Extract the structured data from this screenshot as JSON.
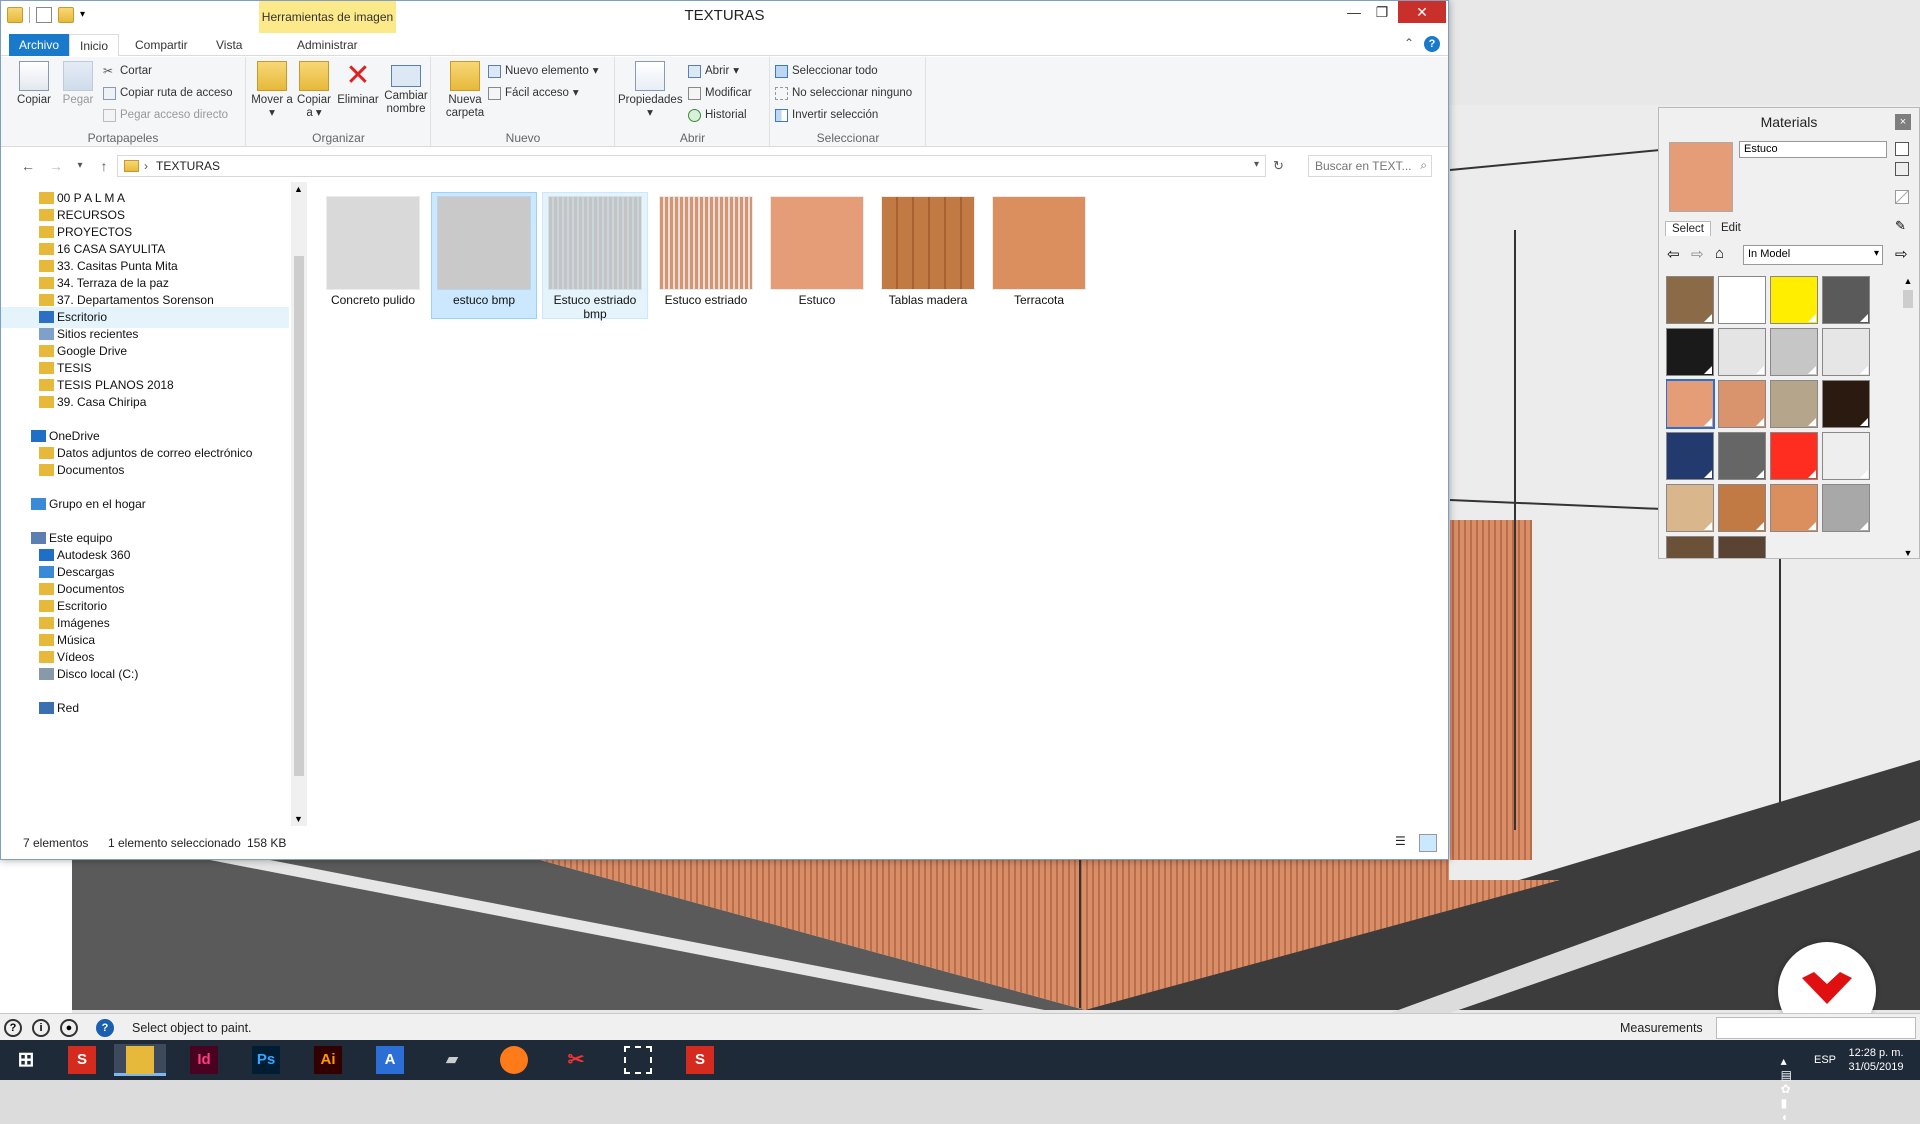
{
  "window": {
    "title": "TEXTURAS",
    "context_tab": "Herramientas de imagen",
    "minimize": "—",
    "maximize": "❐",
    "close": "✕"
  },
  "ribbon": {
    "tabs": [
      "Archivo",
      "Inicio",
      "Compartir",
      "Vista",
      "Administrar"
    ],
    "portapapeles": {
      "label": "Portapapeles",
      "copiar": "Copiar",
      "pegar": "Pegar",
      "cortar": "Cortar",
      "copiar_ruta": "Copiar ruta de acceso",
      "pegar_acceso": "Pegar acceso directo"
    },
    "organizar": {
      "label": "Organizar",
      "mover": "Mover a",
      "copiar": "Copiar a",
      "eliminar": "Eliminar",
      "cambiar": "Cambiar nombre"
    },
    "nuevo": {
      "label": "Nuevo",
      "nueva_carpeta": "Nueva carpeta",
      "nuevo_elemento": "Nuevo elemento",
      "facil_acceso": "Fácil acceso"
    },
    "abrir": {
      "label": "Abrir",
      "propiedades": "Propiedades",
      "abrir": "Abrir",
      "modificar": "Modificar",
      "historial": "Historial"
    },
    "seleccionar": {
      "label": "Seleccionar",
      "todo": "Seleccionar todo",
      "ninguno": "No seleccionar ninguno",
      "invertir": "Invertir selección"
    }
  },
  "address": {
    "path": "TEXTURAS",
    "search_placeholder": "Buscar en TEXT..."
  },
  "navpane": [
    {
      "label": "00 P A L M A",
      "icon": "folder"
    },
    {
      "label": "RECURSOS",
      "icon": "folder"
    },
    {
      "label": "PROYECTOS",
      "icon": "folder"
    },
    {
      "label": "16 CASA SAYULITA",
      "icon": "folder"
    },
    {
      "label": "33. Casitas Punta Mita",
      "icon": "folder"
    },
    {
      "label": "34. Terraza de la paz",
      "icon": "folder"
    },
    {
      "label": "37. Departamentos Sorenson",
      "icon": "folder"
    },
    {
      "label": "Escritorio",
      "icon": "desktop"
    },
    {
      "label": "Sitios recientes",
      "icon": "recent"
    },
    {
      "label": "Google Drive",
      "icon": "folder"
    },
    {
      "label": "TESIS",
      "icon": "folder"
    },
    {
      "label": "TESIS PLANOS 2018",
      "icon": "folder"
    },
    {
      "label": "39. Casa Chiripa",
      "icon": "folder"
    },
    {
      "label": "OneDrive",
      "icon": "cloud"
    },
    {
      "label": "Datos adjuntos de correo electrónico",
      "icon": "folder"
    },
    {
      "label": "Documentos",
      "icon": "folder"
    },
    {
      "label": "Grupo en el hogar",
      "icon": "homegroup"
    },
    {
      "label": "Este equipo",
      "icon": "computer"
    },
    {
      "label": "Autodesk 360",
      "icon": "cloud"
    },
    {
      "label": "Descargas",
      "icon": "download"
    },
    {
      "label": "Documentos",
      "icon": "folder"
    },
    {
      "label": "Escritorio",
      "icon": "folder"
    },
    {
      "label": "Imágenes",
      "icon": "folder"
    },
    {
      "label": "Música",
      "icon": "folder"
    },
    {
      "label": "Vídeos",
      "icon": "folder"
    },
    {
      "label": "Disco local (C:)",
      "icon": "drive"
    },
    {
      "label": "Red",
      "icon": "network"
    }
  ],
  "files": [
    {
      "name": "Concreto pulido",
      "color": "#d9d9d9"
    },
    {
      "name": "estuco bmp",
      "color": "#c9c9c9"
    },
    {
      "name": "Estuco estriado bmp",
      "color": "#c4c4c4"
    },
    {
      "name": "Estuco estriado",
      "color": "#d9946d"
    },
    {
      "name": "Estuco",
      "color": "#e59d77"
    },
    {
      "name": "Tablas madera",
      "color": "#c27a45"
    },
    {
      "name": "Terracota",
      "color": "#dc8f5e"
    }
  ],
  "status": {
    "count": "7 elementos",
    "selection": "1 elemento seleccionado",
    "size": "158 KB"
  },
  "materials": {
    "title": "Materials",
    "close": "×",
    "name": "Estuco",
    "tab_select": "Select",
    "tab_edit": "Edit",
    "collection": "In Model",
    "swatches": [
      "#8b6a48",
      "#ffffff",
      "#ffee00",
      "#5a5a5a",
      "#1a1a1a",
      "#e4e4e4",
      "#c6c6c6",
      "#e6e6e6",
      "#e59d77",
      "#d9946d",
      "#b5a58a",
      "#2a1a10",
      "#223a6e",
      "#666666",
      "#ff2d20",
      "#eeeeee",
      "#d9b68c",
      "#c27a45",
      "#dc8f5e",
      "#a8a8a8",
      "#6b5138",
      "#5b4333"
    ]
  },
  "sketchup_status": {
    "message": "Select object to paint.",
    "measurements": "Measurements"
  },
  "taskbar": {
    "apps": [
      "start-button",
      "sketchup",
      "file-explorer",
      "indesign",
      "photoshop",
      "illustrator",
      "app-blue",
      "app-stack",
      "firefox",
      "snipping",
      "capture",
      "sketchup-2"
    ],
    "lang": "ESP",
    "time": "12:28 p. m.",
    "date": "31/05/2019"
  }
}
